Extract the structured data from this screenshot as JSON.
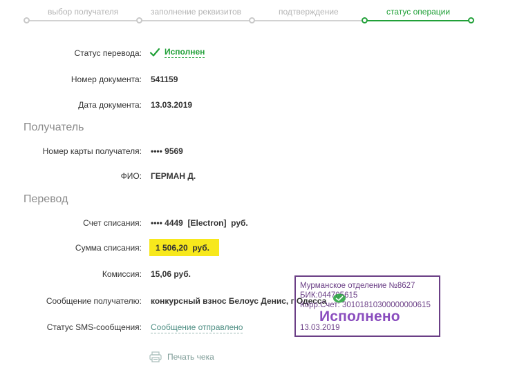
{
  "stepper": {
    "steps": [
      {
        "label": "выбор получателя"
      },
      {
        "label": "заполнение реквизитов"
      },
      {
        "label": "подтверждение"
      },
      {
        "label": "статус операции"
      }
    ],
    "active_index": 3
  },
  "status": {
    "label": "Статус перевода:",
    "value": "Исполнен"
  },
  "document": {
    "number_label": "Номер документа:",
    "number_value": "541159",
    "date_label": "Дата документа:",
    "date_value": "13.03.2019"
  },
  "recipient": {
    "section_title": "Получатель",
    "card_label": "Номер карты получателя:",
    "card_value": "•••• 9569",
    "name_label": "ФИО:",
    "name_value": "ГЕРМАН Д."
  },
  "transfer": {
    "section_title": "Перевод",
    "account_label": "Счет списания:",
    "account_value": "•••• 4449  [Electron]  руб.",
    "amount_label": "Сумма списания:",
    "amount_value": "1 506,20  руб.",
    "fee_label": "Комиссия:",
    "fee_value": "15,06 руб.",
    "message_label": "Сообщение получателю:",
    "message_value": "конкурсный взнос Белоус Денис, г Одесса",
    "sms_label": "Статус SMS-сообщения:",
    "sms_value": "Сообщение отправлено"
  },
  "actions": {
    "print_label": "Печать чека"
  },
  "stamp": {
    "line1": "Мурманское отделение №8627",
    "line2": "БИК:044705615",
    "line3": "Корр.Счет: 30101810300000000615",
    "big": "Исполнено",
    "date": "13.03.2019"
  },
  "colors": {
    "accent_green": "#21a038",
    "highlight_yellow": "#f7e81c",
    "stamp_purple": "#6b3f86"
  }
}
